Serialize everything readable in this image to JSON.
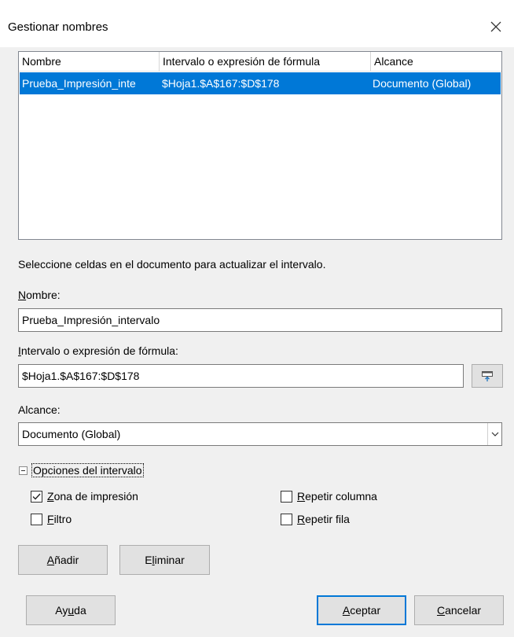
{
  "dialog": {
    "title": "Gestionar nombres",
    "close_icon": "close-icon"
  },
  "list": {
    "columns": [
      "Nombre",
      "Intervalo o expresión de fórmula",
      "Alcance"
    ],
    "rows": [
      {
        "name": "Prueba_Impresión_inte",
        "range": "$Hoja1.$A$167:$D$178",
        "scope": "Documento (Global)",
        "selected": true
      }
    ]
  },
  "hint": "Seleccione celdas en el documento para actualizar el intervalo.",
  "name_field": {
    "label_u": "N",
    "label_rest": "ombre:",
    "value": "Prueba_Impresión_intervalo"
  },
  "range_field": {
    "label_u": "I",
    "label_rest": "ntervalo o expresión de fórmula:",
    "value": "$Hoja1.$A$167:$D$178"
  },
  "scope_field": {
    "label": "Alcance:",
    "value": "Documento (Global)"
  },
  "options": {
    "label": "Opciones del intervalo",
    "print_area": {
      "u": "Z",
      "rest": "ona de impresión",
      "checked": true
    },
    "filter": {
      "u": "F",
      "rest": "iltro",
      "checked": false
    },
    "repeat_column": {
      "u": "R",
      "rest": "epetir columna",
      "checked": false
    },
    "repeat_row": {
      "u": "R",
      "rest": "epetir fila",
      "checked": false
    }
  },
  "buttons": {
    "add": {
      "u": "A",
      "rest": "ñadir"
    },
    "delete": {
      "pre": "E",
      "u": "l",
      "rest": "iminar"
    },
    "help": {
      "pre": "Ay",
      "u": "u",
      "rest": "da"
    },
    "ok": {
      "u": "A",
      "rest": "ceptar"
    },
    "cancel": {
      "u": "C",
      "rest": "ancelar"
    }
  },
  "colors": {
    "selection": "#0078d7",
    "face": "#f0f0f0",
    "button": "#e1e1e1"
  }
}
